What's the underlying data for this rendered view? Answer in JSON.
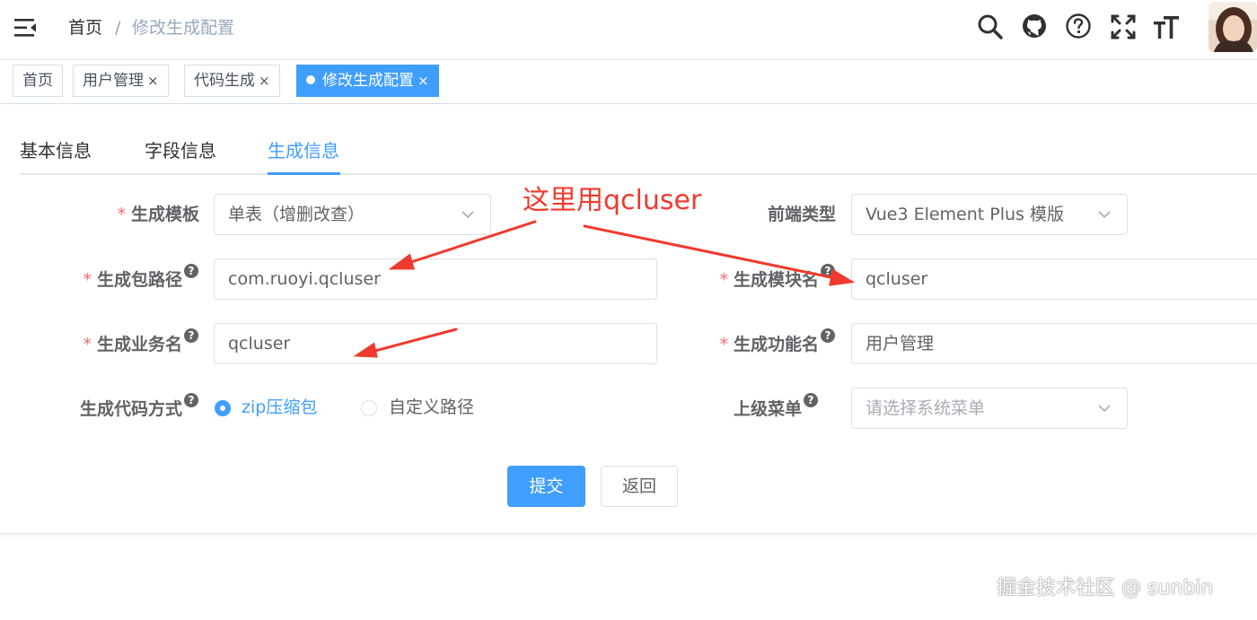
{
  "breadcrumb": {
    "home": "首页",
    "separator": "/",
    "current": "修改生成配置"
  },
  "navbar_icons": [
    "search-icon",
    "github-icon",
    "question-icon",
    "fullscreen-icon",
    "text-size-icon"
  ],
  "tags": [
    {
      "label": "首页",
      "closable": false,
      "active": false
    },
    {
      "label": "用户管理",
      "closable": true,
      "active": false
    },
    {
      "label": "代码生成",
      "closable": true,
      "active": false
    },
    {
      "label": "修改生成配置",
      "closable": true,
      "active": true
    }
  ],
  "tag_close": "×",
  "tabs": [
    "基本信息",
    "字段信息",
    "生成信息"
  ],
  "form": {
    "tpl_label": "生成模板",
    "tpl_value": "单表（增删改查）",
    "frontend_label": "前端类型",
    "frontend_value": "Vue3 Element Plus 模版",
    "package_label": "生成包路径",
    "package_value": "com.ruoyi.qcluser",
    "module_label": "生成模块名",
    "module_value": "qcluser",
    "business_label": "生成业务名",
    "business_value": "qcluser",
    "function_label": "生成功能名",
    "function_value": "用户管理",
    "gentype_label": "生成代码方式",
    "gentype_options": [
      "zip压缩包",
      "自定义路径"
    ],
    "gentype_selected": "zip压缩包",
    "parent_menu_label": "上级菜单",
    "parent_menu_placeholder": "请选择系统菜单",
    "required_mark": "*",
    "help_mark": "?"
  },
  "buttons": {
    "submit": "提交",
    "back": "返回"
  },
  "annotation": {
    "text": "这里用qcluser",
    "color": "#f03a2e"
  },
  "watermark": "掘金技术社区 @ sunbin",
  "colors": {
    "primary": "#409eff",
    "required": "#f56c6c"
  }
}
